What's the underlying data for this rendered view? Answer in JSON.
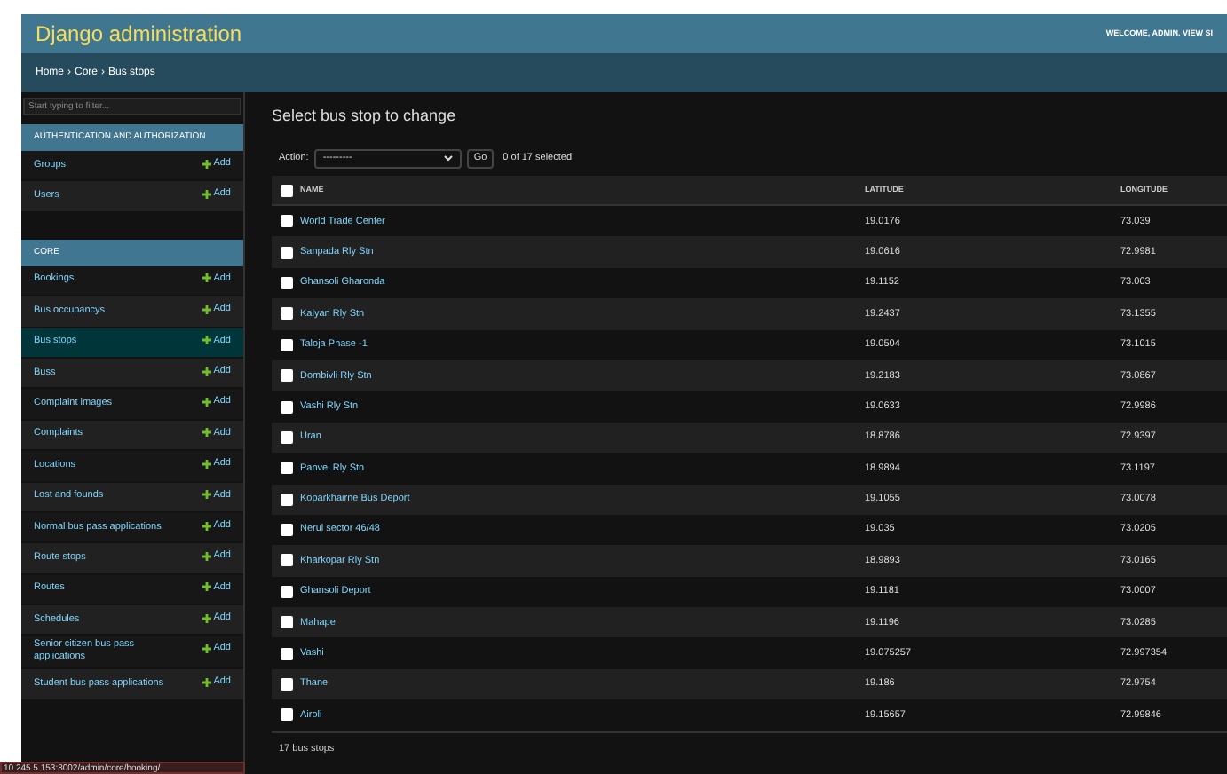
{
  "header": {
    "title": "Django administration",
    "user_tools": "WELCOME, ADMIN. VIEW SI"
  },
  "breadcrumbs": [
    "Home",
    "Core",
    "Bus stops"
  ],
  "breadcrumb_separator": "›",
  "sidebar": {
    "filter_placeholder": "Start typing to filter...",
    "apps": [
      {
        "title": "AUTHENTICATION AND AUTHORIZATION",
        "models": [
          {
            "name": "Groups",
            "add": "Add",
            "selected": false
          },
          {
            "name": "Users",
            "add": "Add",
            "selected": false
          }
        ]
      },
      {
        "title": "CORE",
        "models": [
          {
            "name": "Bookings",
            "add": "Add",
            "selected": false
          },
          {
            "name": "Bus occupancys",
            "add": "Add",
            "selected": false
          },
          {
            "name": "Bus stops",
            "add": "Add",
            "selected": true
          },
          {
            "name": "Buss",
            "add": "Add",
            "selected": false
          },
          {
            "name": "Complaint images",
            "add": "Add",
            "selected": false
          },
          {
            "name": "Complaints",
            "add": "Add",
            "selected": false
          },
          {
            "name": "Locations",
            "add": "Add",
            "selected": false
          },
          {
            "name": "Lost and founds",
            "add": "Add",
            "selected": false
          },
          {
            "name": "Normal bus pass applications",
            "add": "Add",
            "selected": false
          },
          {
            "name": "Route stops",
            "add": "Add",
            "selected": false
          },
          {
            "name": "Routes",
            "add": "Add",
            "selected": false
          },
          {
            "name": "Schedules",
            "add": "Add",
            "selected": false
          },
          {
            "name": "Senior citizen bus pass applications",
            "add": "Add",
            "selected": false
          },
          {
            "name": "Student bus pass applications",
            "add": "Add",
            "selected": false
          }
        ]
      }
    ]
  },
  "content": {
    "title": "Select bus stop to change",
    "actions": {
      "label": "Action:",
      "value": "---------",
      "go": "Go",
      "counter": "0 of 17 selected"
    },
    "table": {
      "columns": [
        "NAME",
        "LATITUDE",
        "LONGITUDE"
      ],
      "all_checked": false,
      "rows": [
        {
          "name": "World Trade Center",
          "latitude": "19.0176",
          "longitude": "73.039",
          "checked": false
        },
        {
          "name": "Sanpada Rly Stn",
          "latitude": "19.0616",
          "longitude": "72.9981",
          "checked": false
        },
        {
          "name": "Ghansoli Gharonda",
          "latitude": "19.1152",
          "longitude": "73.003",
          "checked": false
        },
        {
          "name": "Kalyan Rly Stn",
          "latitude": "19.2437",
          "longitude": "73.1355",
          "checked": false
        },
        {
          "name": "Taloja Phase -1",
          "latitude": "19.0504",
          "longitude": "73.1015",
          "checked": false
        },
        {
          "name": "Dombivli Rly Stn",
          "latitude": "19.2183",
          "longitude": "73.0867",
          "checked": false
        },
        {
          "name": "Vashi Rly Stn",
          "latitude": "19.0633",
          "longitude": "72.9986",
          "checked": false
        },
        {
          "name": "Uran",
          "latitude": "18.8786",
          "longitude": "72.9397",
          "checked": false
        },
        {
          "name": "Panvel Rly Stn",
          "latitude": "18.9894",
          "longitude": "73.1197",
          "checked": false
        },
        {
          "name": "Koparkhairne Bus Deport",
          "latitude": "19.1055",
          "longitude": "73.0078",
          "checked": false
        },
        {
          "name": "Nerul sector 46/48",
          "latitude": "19.035",
          "longitude": "73.0205",
          "checked": false
        },
        {
          "name": "Kharkopar Rly Stn",
          "latitude": "18.9893",
          "longitude": "73.0165",
          "checked": false
        },
        {
          "name": "Ghansoli Deport",
          "latitude": "19.1181",
          "longitude": "73.0007",
          "checked": false
        },
        {
          "name": "Mahape",
          "latitude": "19.1196",
          "longitude": "73.0285",
          "checked": false
        },
        {
          "name": "Vashi",
          "latitude": "19.075257",
          "longitude": "72.997354",
          "checked": false
        },
        {
          "name": "Thane",
          "latitude": "19.186",
          "longitude": "72.9754",
          "checked": false
        },
        {
          "name": "Airoli",
          "latitude": "19.15657",
          "longitude": "72.99846",
          "checked": false
        }
      ]
    },
    "paginator": "17 bus stops"
  },
  "status_bar": "10.245.5.153:8002/admin/core/booking/"
}
